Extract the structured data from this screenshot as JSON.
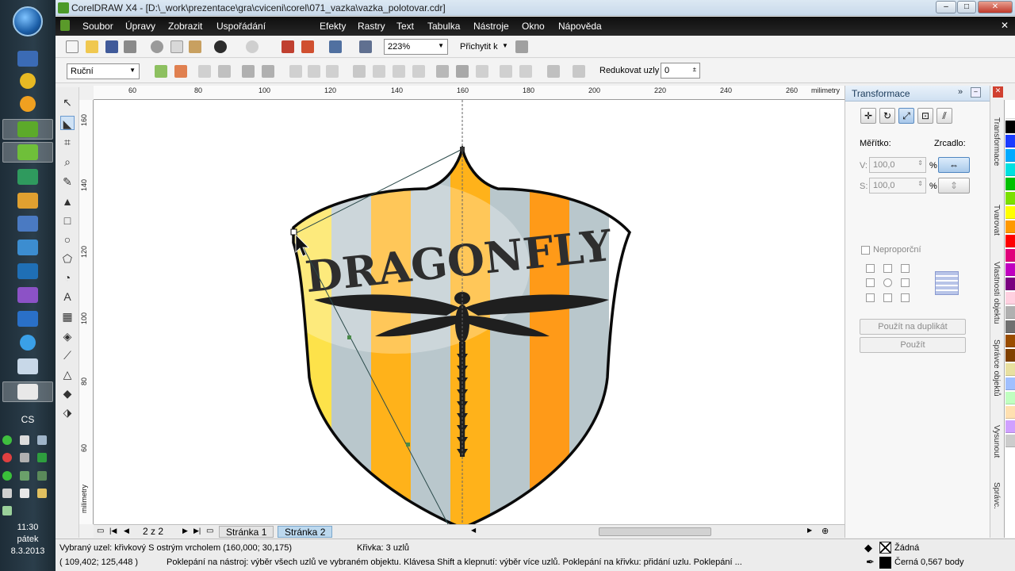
{
  "taskbar": {
    "language": "CS",
    "time": "11:30",
    "weekday": "pátek",
    "date": "8.3.2013"
  },
  "window": {
    "title": "CorelDRAW X4 - [D:\\_work\\prezentace\\gra\\cviceni\\corel\\071_vazka\\vazka_polotovar.cdr]",
    "minimize": "–",
    "maximize": "□",
    "close": "✕"
  },
  "menu": [
    "Soubor",
    "Úpravy",
    "Zobrazit",
    "Uspořádání",
    "Efekty",
    "Rastry",
    "Text",
    "Tabulka",
    "Nástroje",
    "Okno",
    "Nápověda"
  ],
  "toolbar": {
    "zoom_value": "223%",
    "snap_label": "Přichytit k"
  },
  "property_bar": {
    "selection_mode": "Ruční",
    "reduce_nodes_label": "Redukovat uzly",
    "reduce_nodes_value": "0"
  },
  "rulers": {
    "horizontal": [
      "60",
      "80",
      "100",
      "120",
      "140",
      "160",
      "180",
      "200",
      "220",
      "240",
      "260"
    ],
    "unit": "milimetry",
    "vertical": [
      "160",
      "140",
      "120",
      "100",
      "80",
      "60"
    ]
  },
  "artwork": {
    "logo_text": "DRAGONFLY",
    "stripe_colors": [
      "#fde24a",
      "#b9c7cc",
      "#ffb21a",
      "#b9c7cc",
      "#ffb21a",
      "#b9c7cc",
      "#ff9a18",
      "#b9c7cc"
    ]
  },
  "page_nav": {
    "page_count": "2 z 2",
    "tabs": [
      "Stránka 1",
      "Stránka 2"
    ]
  },
  "status": {
    "node_info": "Vybraný uzel: křivkový S ostrým vrcholem (160,000; 30,175)",
    "curve_info": "Křivka: 3 uzlů",
    "coords": "( 109,402; 125,448 )",
    "hint": "Poklepání na nástroj: výběr všech uzlů ve vybraném objektu. Klávesa Shift a klepnutí: výběr více uzlů. Poklepání na křivku: přidání uzlu. Poklepání ...",
    "fill": "Žádná",
    "outline": "Černá  0,567 body"
  },
  "docker": {
    "title": "Transformace",
    "scale_label": "Měřítko:",
    "mirror_label": "Zrcadlo:",
    "h_axis": "V:",
    "v_axis": "S:",
    "h_value": "100,0",
    "v_value": "100,0",
    "unit": "%",
    "nonproportional_label": "Neproporční",
    "apply_duplicate": "Použít na duplikát",
    "apply": "Použít"
  },
  "side_tabs": [
    "Transformace",
    "Tvarovat",
    "Vlastnosti objektu",
    "Správce objektů",
    "Vysunout",
    "Správc."
  ],
  "palette": [
    "#ffffff",
    "#000000",
    "#1a3bff",
    "#00aaff",
    "#00e0e0",
    "#00c000",
    "#7be000",
    "#ffff00",
    "#ff9900",
    "#ff0000",
    "#e0007a",
    "#c000c0",
    "#7a0080",
    "#ffd0e0",
    "#b0b0b0",
    "#707070",
    "#9a4d00",
    "#804000",
    "#e8e0a0",
    "#a0c0ff",
    "#c0ffc0",
    "#ffe0b0",
    "#d0a0ff",
    "#cccccc"
  ]
}
